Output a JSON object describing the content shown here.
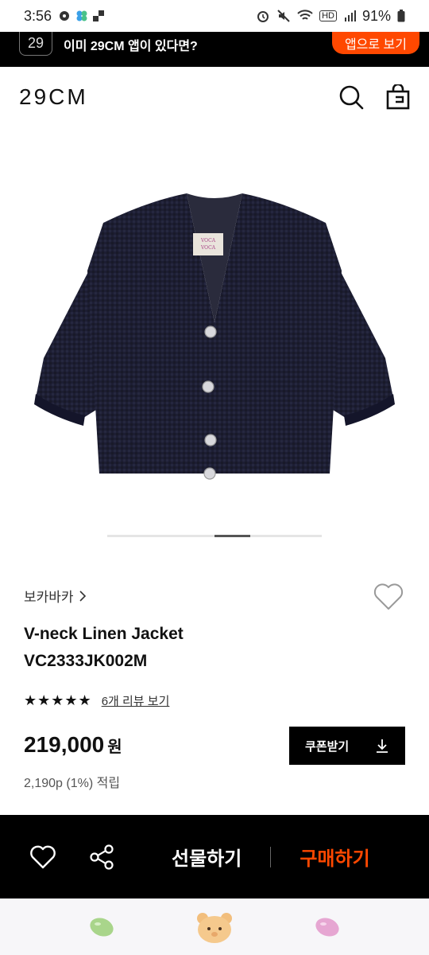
{
  "status_bar": {
    "time": "3:56",
    "battery": "91%",
    "hd_label": "HD"
  },
  "app_banner": {
    "logo_text": "29",
    "message": "이미 29CM 앱이 있다면?",
    "open_app_label": "앱으로 보기"
  },
  "header": {
    "brand": "29CM",
    "search_icon": "search-icon",
    "bag_icon": "shopping-bag-icon"
  },
  "product": {
    "image_icon": "tweed-jacket-photo",
    "brand_label": "보카바카",
    "name_line1": "V-neck Linen Jacket",
    "name_line2": "VC2333JK002M",
    "stars": "★★★★★",
    "review_link": "6개 리뷰 보기",
    "price": "219,000",
    "currency": "원",
    "points": "2,190p (1%) 적립",
    "coupon_label": "쿠폰받기",
    "carousel_progress": 0.5
  },
  "bottom_bar": {
    "gift_label": "선물하기",
    "buy_label": "구매하기"
  },
  "colors": {
    "accent": "#ff4800",
    "black": "#000000"
  }
}
